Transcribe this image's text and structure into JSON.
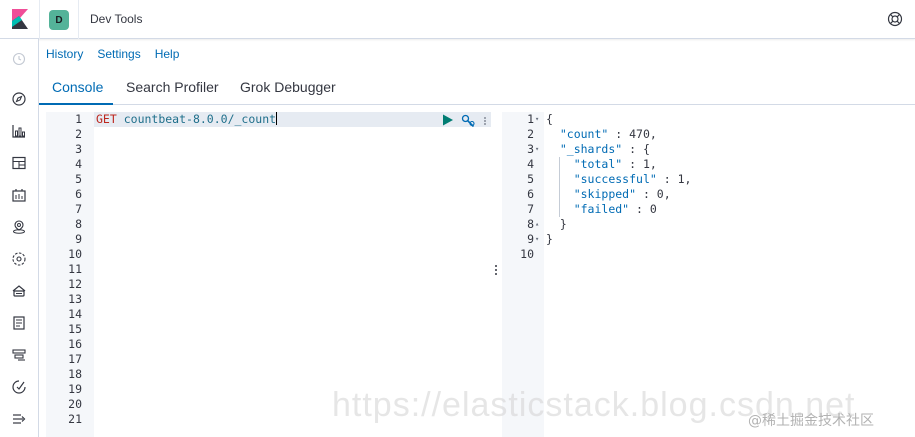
{
  "header": {
    "space_initial": "D",
    "app_title": "Dev Tools",
    "help_icon": "help-icon"
  },
  "submenu": {
    "history": "History",
    "settings": "Settings",
    "help": "Help"
  },
  "tabs": [
    {
      "label": "Console",
      "active": true
    },
    {
      "label": "Search Profiler",
      "active": false
    },
    {
      "label": "Grok Debugger",
      "active": false
    }
  ],
  "nav_icons": [
    "recent-icon",
    "discover-icon",
    "visualize-icon",
    "dashboard-icon",
    "canvas-icon",
    "maps-icon",
    "ml-icon",
    "infrastructure-icon",
    "logs-icon",
    "apm-icon",
    "uptime-icon",
    "collapse-icon"
  ],
  "request_editor": {
    "method": "GET",
    "path": "countbeat-8.0.0/_count",
    "line_numbers": [
      "1",
      "2",
      "3",
      "4",
      "5",
      "6",
      "7",
      "8",
      "9",
      "10",
      "11",
      "12",
      "13",
      "14",
      "15",
      "16",
      "17",
      "18",
      "19",
      "20",
      "21"
    ]
  },
  "response_editor": {
    "line_numbers": [
      "1",
      "2",
      "3",
      "4",
      "5",
      "6",
      "7",
      "8",
      "9",
      "10"
    ],
    "lines": [
      "{",
      "  \"count\" : 470,",
      "  \"_shards\" : {",
      "    \"total\" : 1,",
      "    \"successful\" : 1,",
      "    \"skipped\" : 0,",
      "    \"failed\" : 0",
      "  }",
      "}",
      ""
    ]
  },
  "watermark": {
    "url_text": "https://elasticstack.blog.csdn.net",
    "tag_text": "@稀土掘金技术社区"
  },
  "colors": {
    "accent": "#006bb4",
    "space_badge": "#54b399",
    "play": "#017d73",
    "method": "#bd271e"
  }
}
